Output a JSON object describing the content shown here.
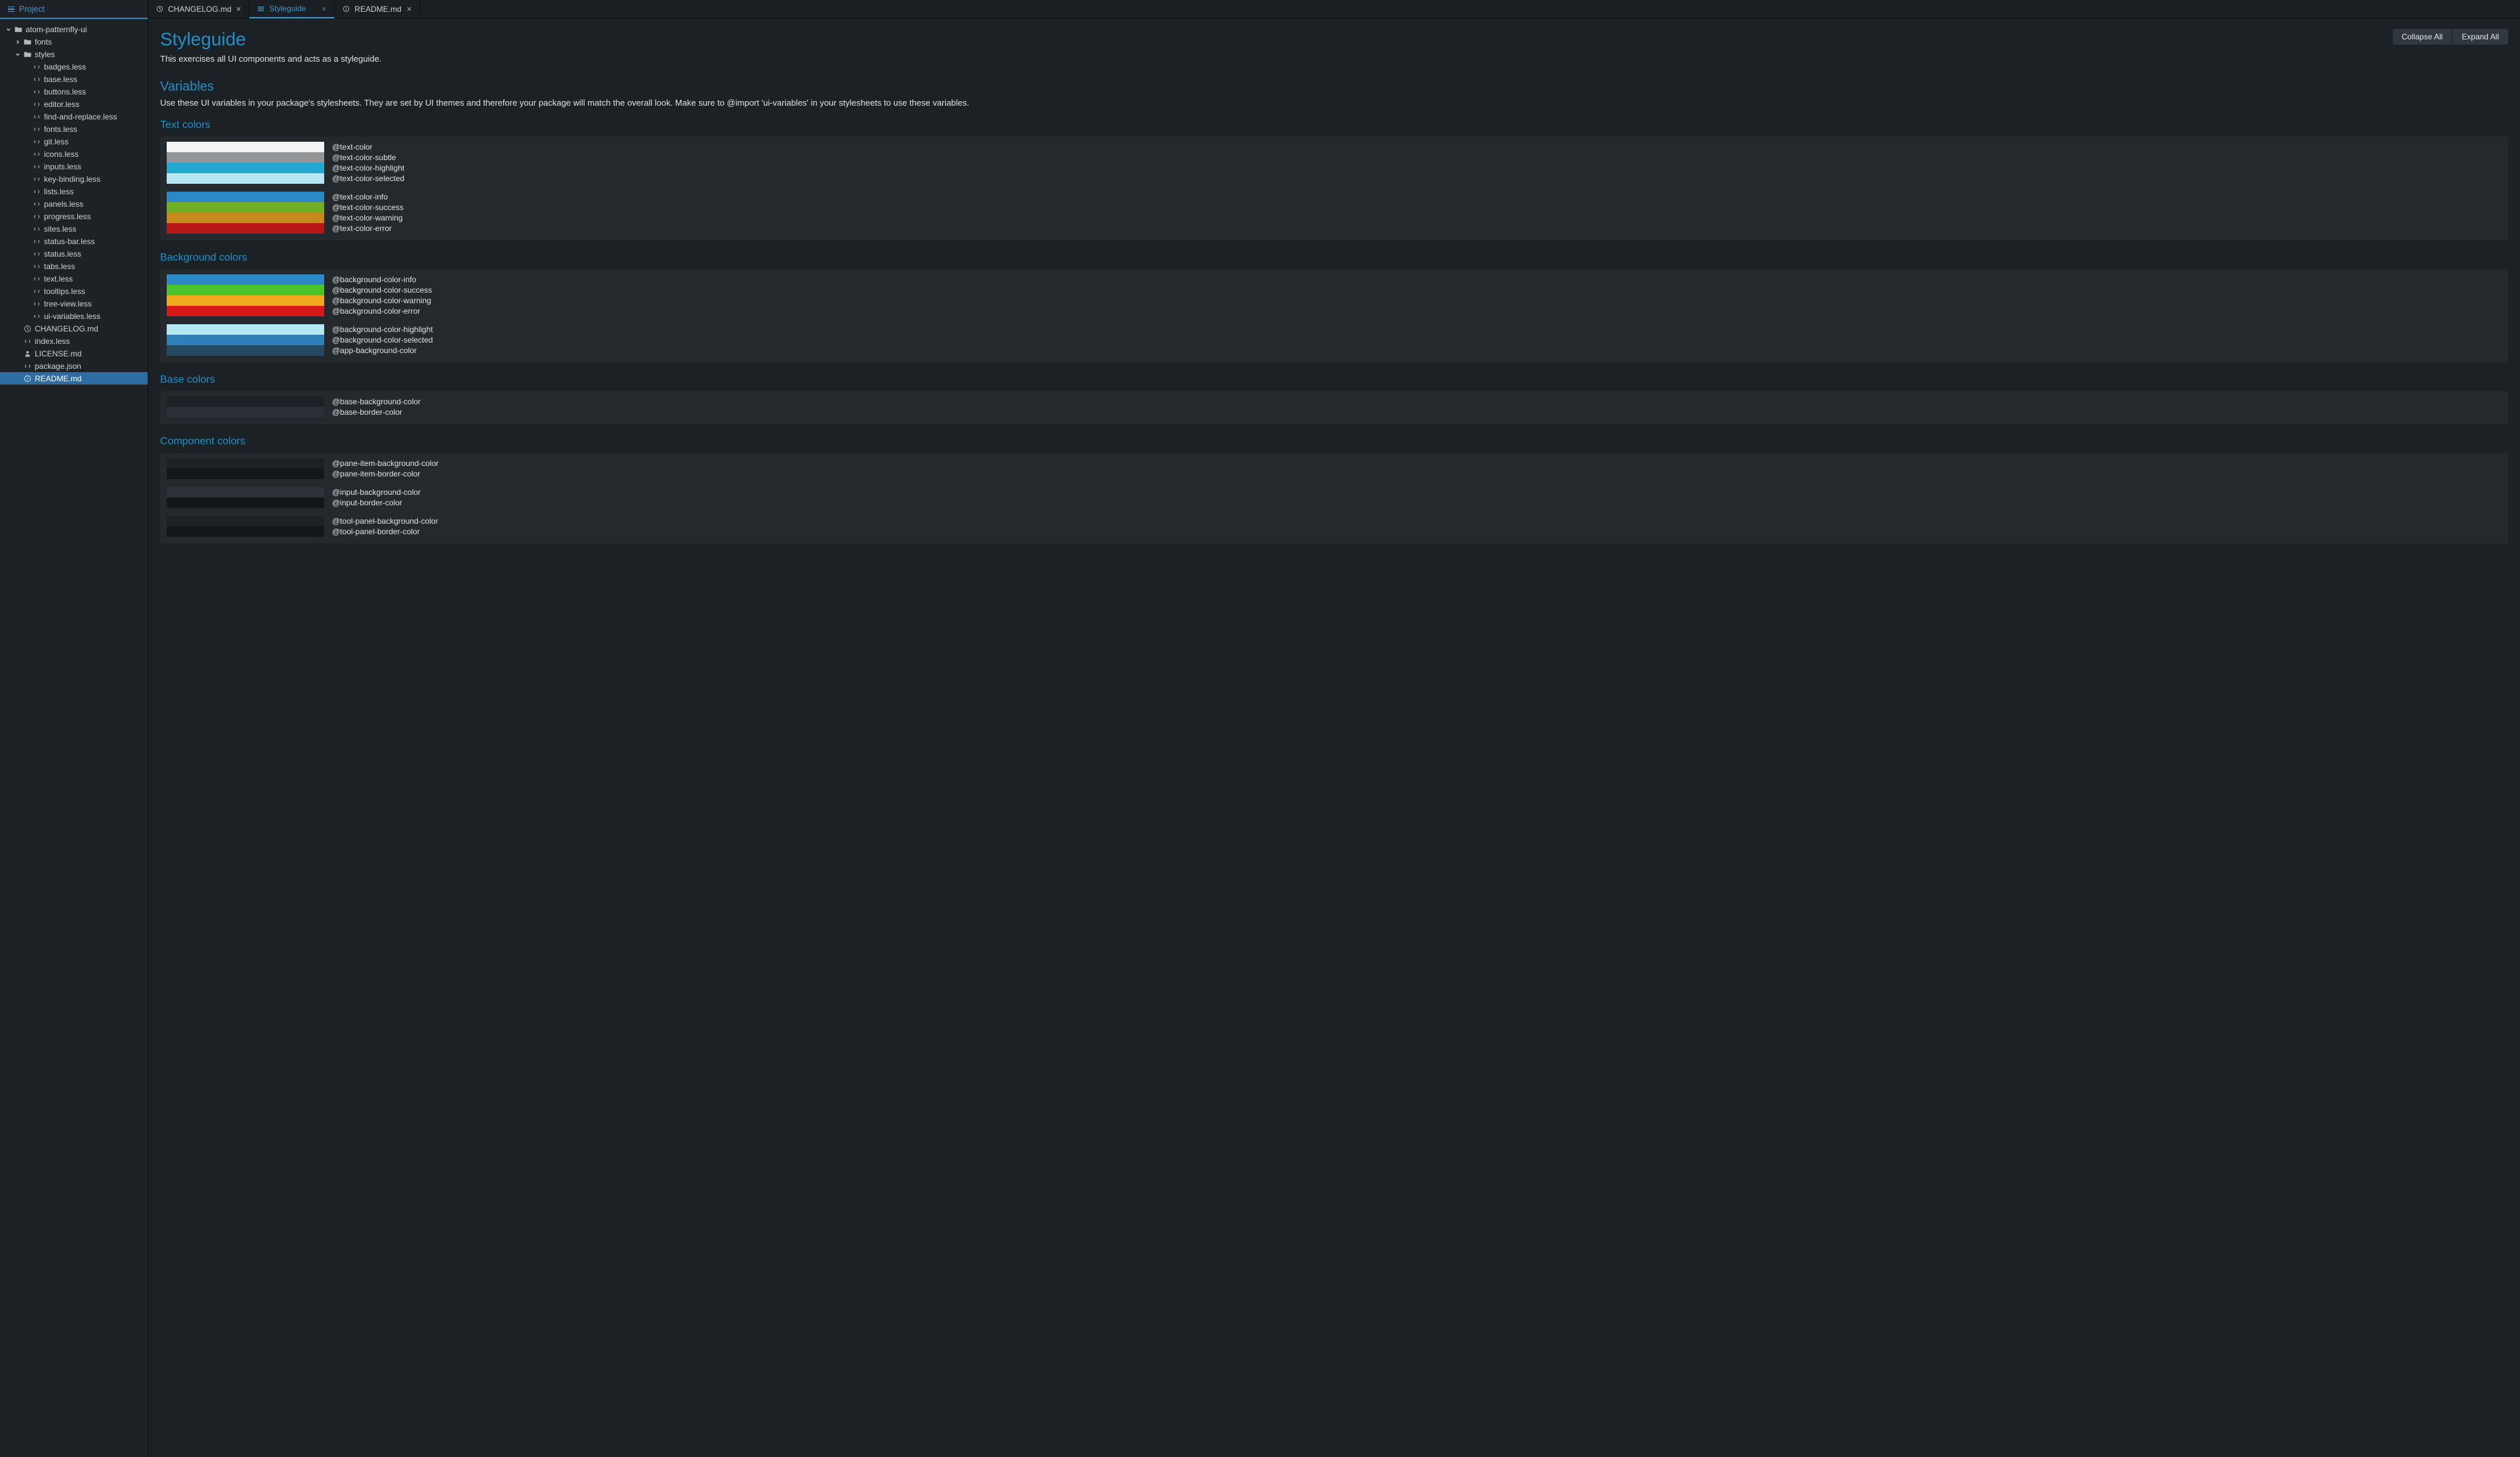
{
  "sidebar": {
    "header": "Project",
    "tree": [
      {
        "depth": 0,
        "label": "atom-patternfly-ui",
        "icon": "folder",
        "chevron": "down"
      },
      {
        "depth": 1,
        "label": "fonts",
        "icon": "folder",
        "chevron": "right"
      },
      {
        "depth": 1,
        "label": "styles",
        "icon": "folder",
        "chevron": "down"
      },
      {
        "depth": 2,
        "label": "badges.less",
        "icon": "file-code"
      },
      {
        "depth": 2,
        "label": "base.less",
        "icon": "file-code"
      },
      {
        "depth": 2,
        "label": "buttons.less",
        "icon": "file-code"
      },
      {
        "depth": 2,
        "label": "editor.less",
        "icon": "file-code"
      },
      {
        "depth": 2,
        "label": "find-and-replace.less",
        "icon": "file-code"
      },
      {
        "depth": 2,
        "label": "fonts.less",
        "icon": "file-code"
      },
      {
        "depth": 2,
        "label": "git.less",
        "icon": "file-code"
      },
      {
        "depth": 2,
        "label": "icons.less",
        "icon": "file-code"
      },
      {
        "depth": 2,
        "label": "inputs.less",
        "icon": "file-code"
      },
      {
        "depth": 2,
        "label": "key-binding.less",
        "icon": "file-code"
      },
      {
        "depth": 2,
        "label": "lists.less",
        "icon": "file-code"
      },
      {
        "depth": 2,
        "label": "panels.less",
        "icon": "file-code"
      },
      {
        "depth": 2,
        "label": "progress.less",
        "icon": "file-code"
      },
      {
        "depth": 2,
        "label": "sites.less",
        "icon": "file-code"
      },
      {
        "depth": 2,
        "label": "status-bar.less",
        "icon": "file-code"
      },
      {
        "depth": 2,
        "label": "status.less",
        "icon": "file-code"
      },
      {
        "depth": 2,
        "label": "tabs.less",
        "icon": "file-code"
      },
      {
        "depth": 2,
        "label": "text.less",
        "icon": "file-code"
      },
      {
        "depth": 2,
        "label": "tooltips.less",
        "icon": "file-code"
      },
      {
        "depth": 2,
        "label": "tree-view.less",
        "icon": "file-code"
      },
      {
        "depth": 2,
        "label": "ui-variables.less",
        "icon": "file-code"
      },
      {
        "depth": 1,
        "label": "CHANGELOG.md",
        "icon": "clock"
      },
      {
        "depth": 1,
        "label": "index.less",
        "icon": "file-code"
      },
      {
        "depth": 1,
        "label": "LICENSE.md",
        "icon": "person"
      },
      {
        "depth": 1,
        "label": "package.json",
        "icon": "file-code"
      },
      {
        "depth": 1,
        "label": "README.md",
        "icon": "info",
        "selected": true
      }
    ]
  },
  "tabs": [
    {
      "label": "CHANGELOG.md",
      "icon": "clock",
      "active": false
    },
    {
      "label": "Styleguide",
      "icon": "hamburger",
      "active": true
    },
    {
      "label": "README.md",
      "icon": "info",
      "active": false
    }
  ],
  "buttons": {
    "collapse_all": "Collapse All",
    "expand_all": "Expand All"
  },
  "page": {
    "title": "Styleguide",
    "subtitle": "This exercises all UI components and acts as a styleguide.",
    "variables": {
      "title": "Variables",
      "desc": "Use these UI variables in your package's stylesheets. They are set by UI themes and therefore your package will match the overall look. Make sure to @import 'ui-variables' in your stylesheets to use these variables."
    },
    "groups": [
      {
        "title": "Text colors",
        "blocks": [
          [
            {
              "color": "#f4f4f4",
              "name": "@text-color"
            },
            {
              "color": "#939496",
              "name": "@text-color-subtle"
            },
            {
              "color": "#23a8cf",
              "name": "@text-color-highlight"
            },
            {
              "color": "#b5e7f3",
              "name": "@text-color-selected"
            }
          ],
          [
            {
              "color": "#2d89c6",
              "name": "@text-color-info"
            },
            {
              "color": "#6fae26",
              "name": "@text-color-success"
            },
            {
              "color": "#c58a1b",
              "name": "@text-color-warning"
            },
            {
              "color": "#b61616",
              "name": "@text-color-error"
            }
          ]
        ]
      },
      {
        "title": "Background colors",
        "blocks": [
          [
            {
              "color": "#2d89c6",
              "name": "@background-color-info"
            },
            {
              "color": "#4bc32b",
              "name": "@background-color-success"
            },
            {
              "color": "#f0aa1f",
              "name": "@background-color-warning"
            },
            {
              "color": "#d81919",
              "name": "@background-color-error"
            }
          ],
          [
            {
              "color": "#b5e7f3",
              "name": "@background-color-highlight"
            },
            {
              "color": "#2f80b5",
              "name": "@background-color-selected"
            },
            {
              "color": "#234a62",
              "name": "@app-background-color"
            }
          ]
        ]
      },
      {
        "title": "Base colors",
        "blocks": [
          [
            {
              "color": "#1c2126",
              "name": "@base-background-color"
            },
            {
              "color": "#2b3036",
              "name": "@base-border-color"
            }
          ]
        ]
      },
      {
        "title": "Component colors",
        "blocks": [
          [
            {
              "color": "#1c2126",
              "name": "@pane-item-background-color"
            },
            {
              "color": "#14171a",
              "name": "@pane-item-border-color"
            }
          ],
          [
            {
              "color": "#2c3238",
              "name": "@input-background-color"
            },
            {
              "color": "#14171a",
              "name": "@input-border-color"
            }
          ],
          [
            {
              "color": "#1c2126",
              "name": "@tool-panel-background-color"
            },
            {
              "color": "#14171a",
              "name": "@tool-panel-border-color"
            }
          ]
        ]
      }
    ]
  }
}
